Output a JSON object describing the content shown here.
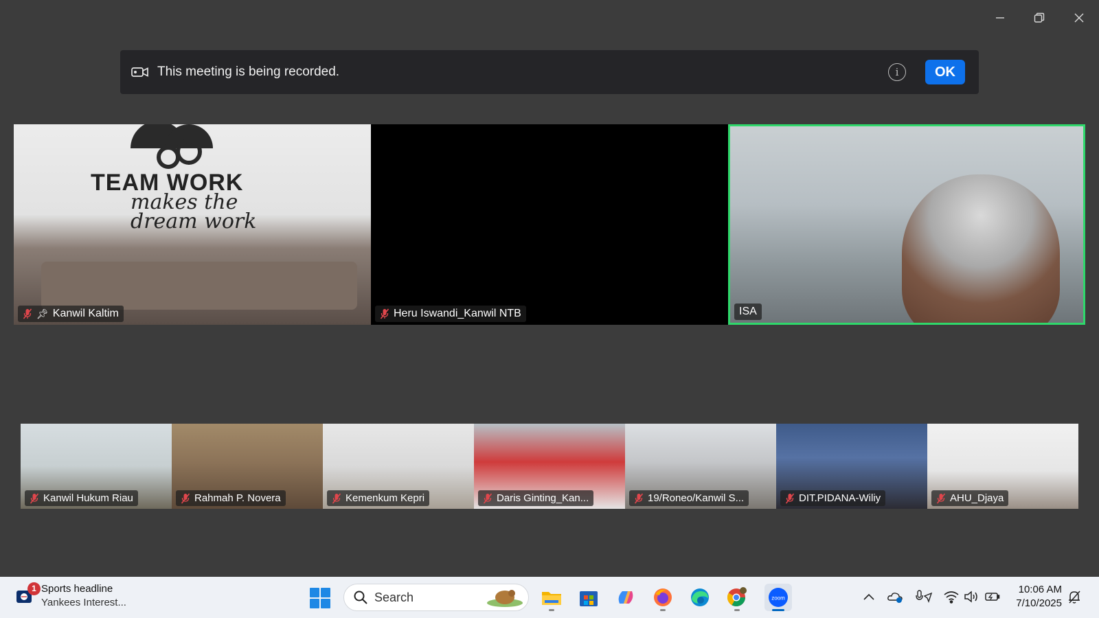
{
  "window": {
    "minimize_icon": "minimize-icon",
    "restore_icon": "restore-icon",
    "close_icon": "close-icon"
  },
  "recording_banner": {
    "message": "This meeting is being recorded.",
    "icon": "video-camera-icon",
    "info_icon": "info-icon",
    "ok_label": "OK"
  },
  "main_tiles": [
    {
      "name": "Kanwil Kaltim",
      "muted": true,
      "pinned": true
    },
    {
      "name": "Heru Iswandi_Kanwil NTB",
      "muted": true,
      "pinned": false
    },
    {
      "name": "ISA",
      "muted": false,
      "active_speaker": true
    }
  ],
  "kaltim_wall": {
    "line1": "TEAM WORK",
    "line2": "makes the",
    "line3": "dream work"
  },
  "strip_tiles": [
    {
      "name": "Kanwil Hukum Riau",
      "muted": true
    },
    {
      "name": "Rahmah P. Novera",
      "muted": true
    },
    {
      "name": "Kemenkum Kepri",
      "muted": true
    },
    {
      "name": "Daris Ginting_Kan...",
      "muted": true
    },
    {
      "name": "19/Roneo/Kanwil S...",
      "muted": true
    },
    {
      "name": "DIT.PIDANA-Wiliy",
      "muted": true
    },
    {
      "name": "AHU_Djaya",
      "muted": true
    }
  ],
  "taskbar": {
    "widget": {
      "badge": "1",
      "title": "Sports headline",
      "subtitle": "Yankees Interest..."
    },
    "search_label": "Search",
    "apps": [
      "file-explorer-icon",
      "microsoft-store-icon",
      "copilot-icon",
      "firefox-icon",
      "edge-icon",
      "chrome-icon",
      "zoom-icon"
    ],
    "zoom_label": "zoom",
    "clock": {
      "time": "10:06 AM",
      "date": "7/10/2025"
    }
  },
  "colors": {
    "active_speaker_border": "#2fd86b",
    "ok_button": "#0e71eb",
    "muted_mic": "#e0464c"
  }
}
